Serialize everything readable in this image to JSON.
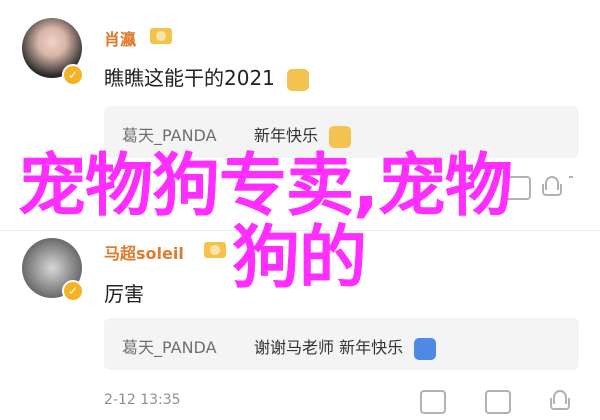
{
  "comments": [
    {
      "username": "肖瀛",
      "text": "瞧瞧这能干的2021",
      "reply": {
        "user": "葛天_PANDA",
        "text": "新年快乐"
      }
    },
    {
      "username": "马超soleil",
      "text": "厉害",
      "reply": {
        "user": "葛天_PANDA",
        "text": "谢谢马老师 新年快乐"
      },
      "timestamp": "2-12 13:35"
    }
  ],
  "watermark": {
    "line1": "宠物狗专卖,宠物",
    "line2": "狗的"
  },
  "colors": {
    "username": "#e07a2b",
    "watermark": "#ff2dff",
    "reply_bg": "#f4f4f4",
    "verified": "#f5b324"
  },
  "icons": [
    "verified-icon",
    "crown-icon",
    "beer-emoji-icon",
    "sparkle-emoji-icon",
    "share-icon",
    "comment-icon",
    "like-icon"
  ]
}
